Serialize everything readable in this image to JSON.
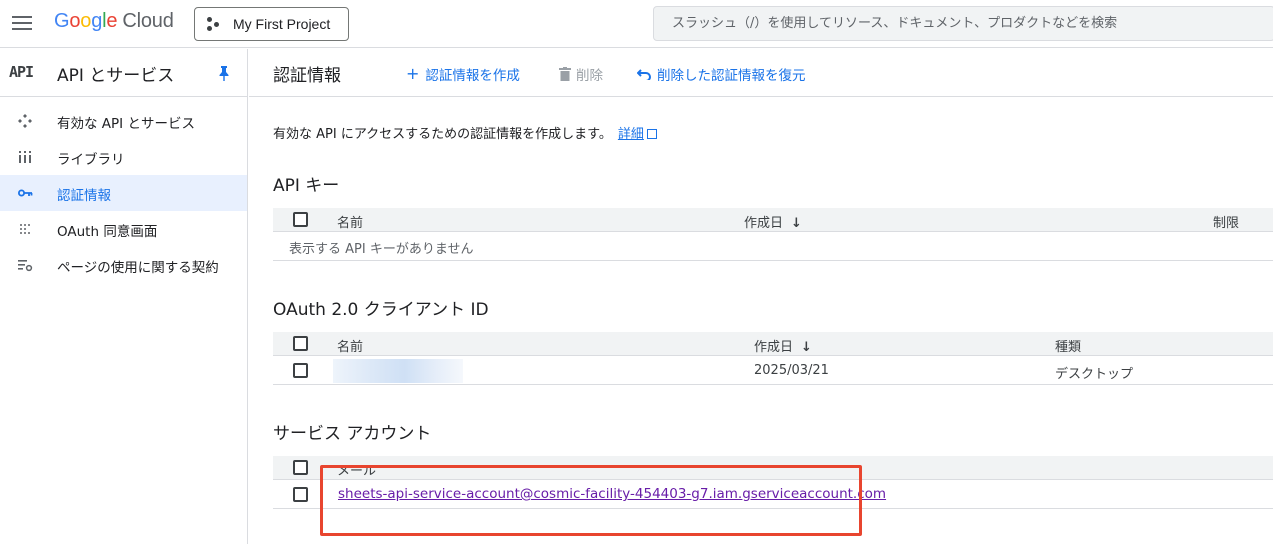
{
  "topbar": {
    "logo_letters": [
      "G",
      "o",
      "o",
      "g",
      "l",
      "e"
    ],
    "logo_cloud": "Cloud",
    "project_label": "My First Project",
    "search_placeholder": "スラッシュ（/）を使用してリソース、ドキュメント、プロダクトなどを検索"
  },
  "sidebar": {
    "badge": "API",
    "title": "API とサービス",
    "items": [
      {
        "label": "有効な API とサービス",
        "icon": "api-network-icon"
      },
      {
        "label": "ライブラリ",
        "icon": "library-icon"
      },
      {
        "label": "認証情報",
        "icon": "key-icon",
        "active": true
      },
      {
        "label": "OAuth 同意画面",
        "icon": "dots-grid-icon"
      },
      {
        "label": "ページの使用に関する契約",
        "icon": "settings-list-icon"
      }
    ]
  },
  "main": {
    "title": "認証情報",
    "toolbar": {
      "create": "認証情報を作成",
      "delete": "削除",
      "restore": "削除した認証情報を復元"
    },
    "intro": "有効な API にアクセスするための認証情報を作成します。",
    "intro_link": "詳細",
    "api_keys": {
      "title": "API キー",
      "col_name": "名前",
      "col_created": "作成日",
      "col_limit": "制限",
      "empty": "表示する API キーがありません"
    },
    "oauth": {
      "title": "OAuth 2.0 クライアント ID",
      "col_name": "名前",
      "col_created": "作成日",
      "col_type": "種類",
      "rows": [
        {
          "created": "2025/03/21",
          "type": "デスクトップ"
        }
      ]
    },
    "service_accounts": {
      "title": "サービス アカウント",
      "col_email": "メール",
      "rows": [
        {
          "email": "sheets-api-service-account@cosmic-facility-454403-g7.iam.gserviceaccount.com"
        }
      ]
    }
  },
  "colors": {
    "accent": "#1a73e8",
    "highlight": "#e8452f",
    "visited_link": "#681da8"
  }
}
